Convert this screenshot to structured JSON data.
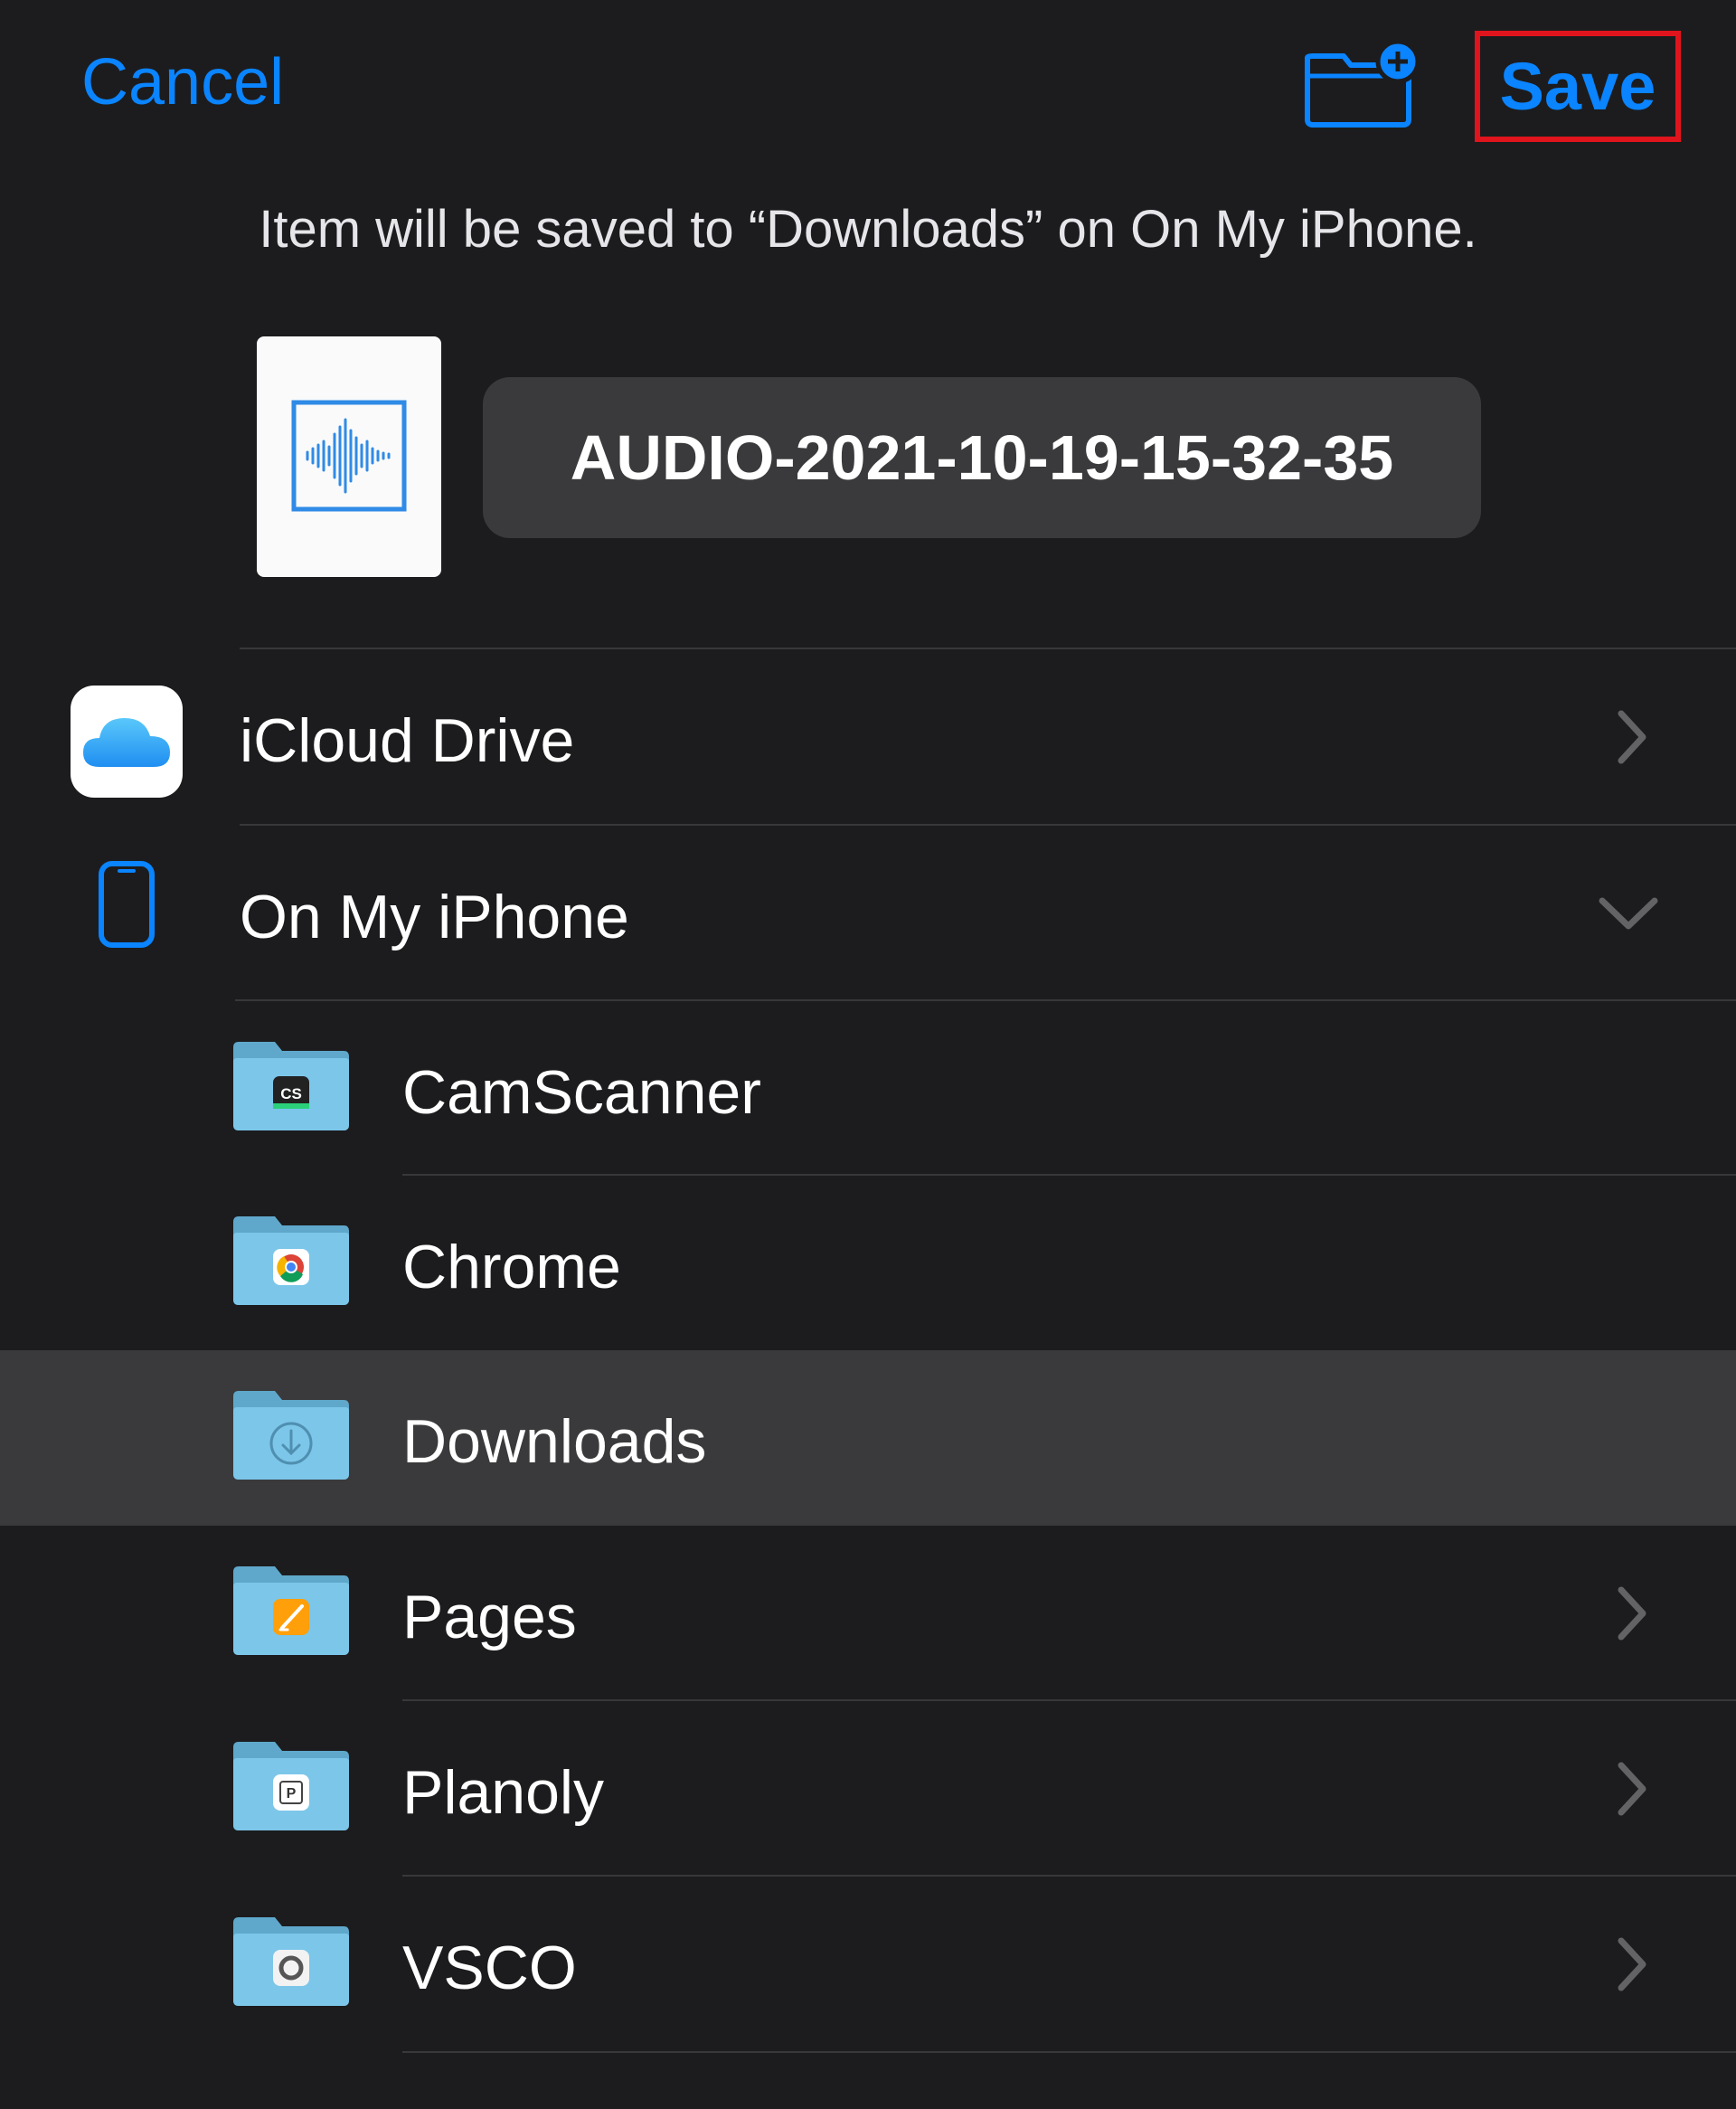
{
  "toolbar": {
    "cancel_label": "Cancel",
    "save_label": "Save",
    "new_folder_icon": "folder-badge-plus-icon"
  },
  "message": "Item will be saved to “Downloads” on On My iPhone.",
  "file": {
    "name": "AUDIO-2021-10-19-15-32-35",
    "icon": "audio-waveform-icon"
  },
  "locations": [
    {
      "label": "iCloud Drive",
      "icon": "icloud-icon",
      "accessory": "chevron-right"
    },
    {
      "label": "On My iPhone",
      "icon": "iphone-icon",
      "accessory": "chevron-down"
    }
  ],
  "folders": [
    {
      "label": "CamScanner",
      "badge": "CS",
      "accessory": "none",
      "selected": false
    },
    {
      "label": "Chrome",
      "badge": "chrome-logo-icon",
      "accessory": "none",
      "selected": false
    },
    {
      "label": "Downloads",
      "badge": "download-arrow-icon",
      "accessory": "none",
      "selected": true
    },
    {
      "label": "Pages",
      "badge": "pages-logo-icon",
      "accessory": "chevron-right",
      "selected": false
    },
    {
      "label": "Planoly",
      "badge": "P",
      "accessory": "chevron-right",
      "selected": false
    },
    {
      "label": "VSCO",
      "badge": "vsco-logo-icon",
      "accessory": "chevron-right",
      "selected": false
    }
  ],
  "colors": {
    "accent": "#0a84ff",
    "background": "#1c1c1e",
    "selected_row": "#3a3a3c",
    "highlight_box": "#e0141c",
    "folder": "#7cc6ea"
  }
}
